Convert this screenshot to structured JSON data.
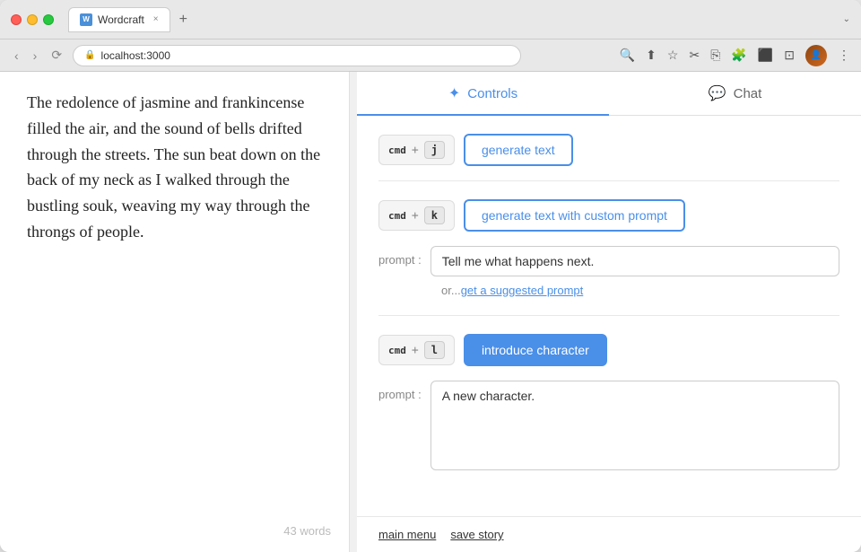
{
  "browser": {
    "tab_label": "Wordcraft",
    "tab_close": "×",
    "new_tab": "+",
    "nav_back": "‹",
    "nav_forward": "›",
    "nav_refresh": "⟳",
    "address": "localhost:3000",
    "chevron": "⌄"
  },
  "toolbar": {
    "icons": [
      "🔍",
      "⬆",
      "☆",
      "✂",
      "⎘",
      "⚙",
      "⬛",
      "⊡"
    ]
  },
  "editor": {
    "text": "The redolence of jasmine and frankincense filled the air, and the sound of bells drifted through the streets. The sun beat down on the back of my neck as I walked through the bustling souk, weaving my way through the throngs of people.",
    "word_count": "43 words"
  },
  "panel": {
    "controls_tab": "Controls",
    "chat_tab": "Chat",
    "controls_icon": "✦",
    "chat_icon": "💬"
  },
  "controls": {
    "cmd1": {
      "modifier": "cmd",
      "plus": "+",
      "key": "j",
      "button_label": "generate text"
    },
    "cmd2": {
      "modifier": "cmd",
      "plus": "+",
      "key": "k",
      "button_label": "generate text with custom prompt",
      "prompt_label": "prompt :",
      "prompt_value": "Tell me what happens next.",
      "suggest_prefix": "or...",
      "suggest_label": "get a suggested prompt"
    },
    "cmd3": {
      "modifier": "cmd",
      "plus": "+",
      "key": "l",
      "button_label": "introduce character",
      "prompt_label": "prompt :",
      "prompt_value": "A new character."
    }
  },
  "bottom_bar": {
    "main_menu": "main menu",
    "save_story": "save story"
  }
}
